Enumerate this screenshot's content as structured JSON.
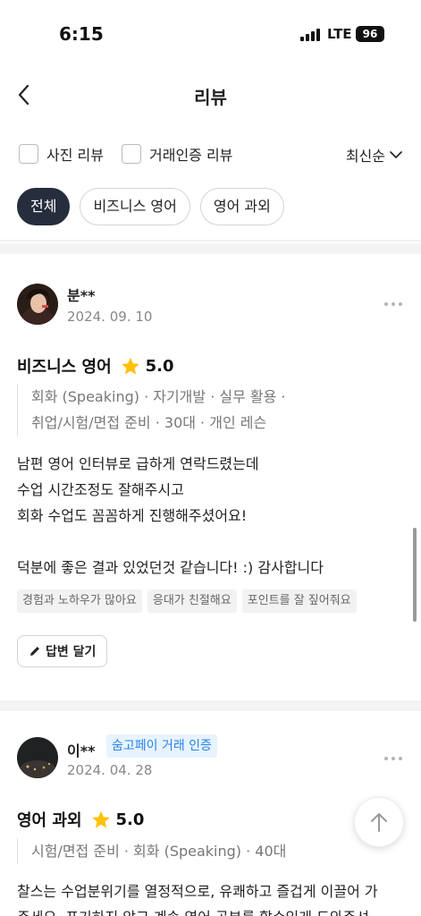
{
  "status_bar": {
    "time": "6:15",
    "network": "LTE",
    "battery": "96"
  },
  "header": {
    "title": "리뷰"
  },
  "filters": {
    "photo_review": "사진 리뷰",
    "verified_review": "거래인증 리뷰",
    "sort": "최신순"
  },
  "categories": [
    {
      "label": "전체",
      "active": true
    },
    {
      "label": "비즈니스 영어",
      "active": false
    },
    {
      "label": "영어 과외",
      "active": false
    }
  ],
  "reviews": [
    {
      "name": "분**",
      "date": "2024. 09. 10",
      "service": "비즈니스 영어",
      "rating": "5.0",
      "tags_line1": "회화 (Speaking) · 자기개발 · 실무 활용 ·",
      "tags_line2": "취업/시험/면접 준비 · 30대 · 개인 레슨",
      "body": "남편 영어 인터뷰로 급하게 연락드렸는데\n수업 시간조정도 잘해주시고\n회화 수업도 꼼꼼하게 진행해주셨어요!\n\n 덕분에 좋은 결과 있었던것 같습니다! :) 감사합니다",
      "keywords": [
        "경험과 노하우가 많아요",
        "응대가 친절해요",
        "포인트를 잘 짚어줘요"
      ],
      "reply_label": "답변 달기"
    },
    {
      "name": "이**",
      "badge": "숨고페이 거래 인증",
      "date": "2024. 04. 28",
      "service": "영어 과외",
      "rating": "5.0",
      "tags_line1": "시험/면접 준비 · 회화 (Speaking) · 40대",
      "body": "찰스는 수업분위기를 열정적으로, 유쾌하고 즐겁게 이끌어 가\n주세요. 포기하지 않고 계속 영어 공부를 할수있게 도와주셔"
    }
  ],
  "colors": {
    "accent": "#262e3d",
    "star": "#ffc107",
    "badge_text": "#2584e8",
    "badge_bg": "#e8f3ff"
  }
}
